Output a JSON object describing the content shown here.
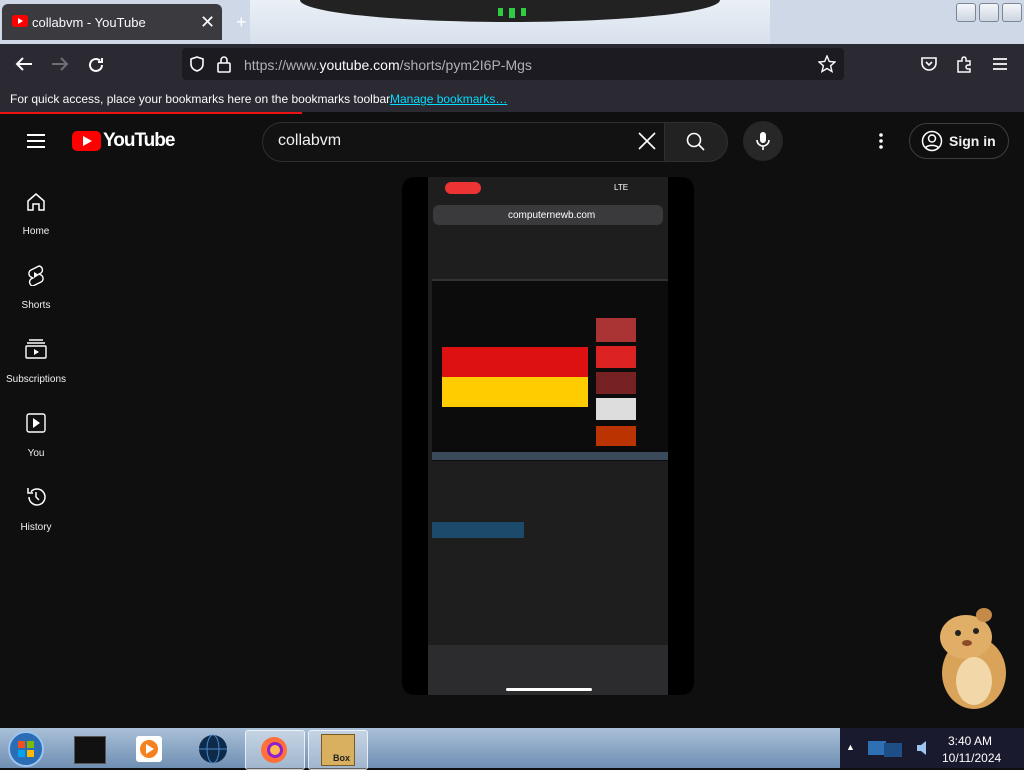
{
  "browser": {
    "tab_title": "collabvm - YouTube",
    "tab_close": "✕",
    "new_tab": "+",
    "url_prefix": "https://www.",
    "url_domain": "youtube.com",
    "url_path": "/shorts/pym2I6P-Mgs",
    "bookmarks_text": "For quick access, place your bookmarks here on the bookmarks toolbar.",
    "bookmarks_link": "Manage bookmarks…"
  },
  "youtube": {
    "logo_text": "YouTube",
    "search_value": "collabvm",
    "sign_in": "Sign in",
    "nav": [
      {
        "label": "Home"
      },
      {
        "label": "Shorts"
      },
      {
        "label": "Subscriptions"
      },
      {
        "label": "You"
      },
      {
        "label": "History"
      }
    ]
  },
  "video_content": {
    "phone_url": "computernewb.com",
    "phone_status": "LTE"
  },
  "taskbar": {
    "time": "3:40 AM",
    "date": "10/11/2024",
    "box_label": "Box"
  }
}
